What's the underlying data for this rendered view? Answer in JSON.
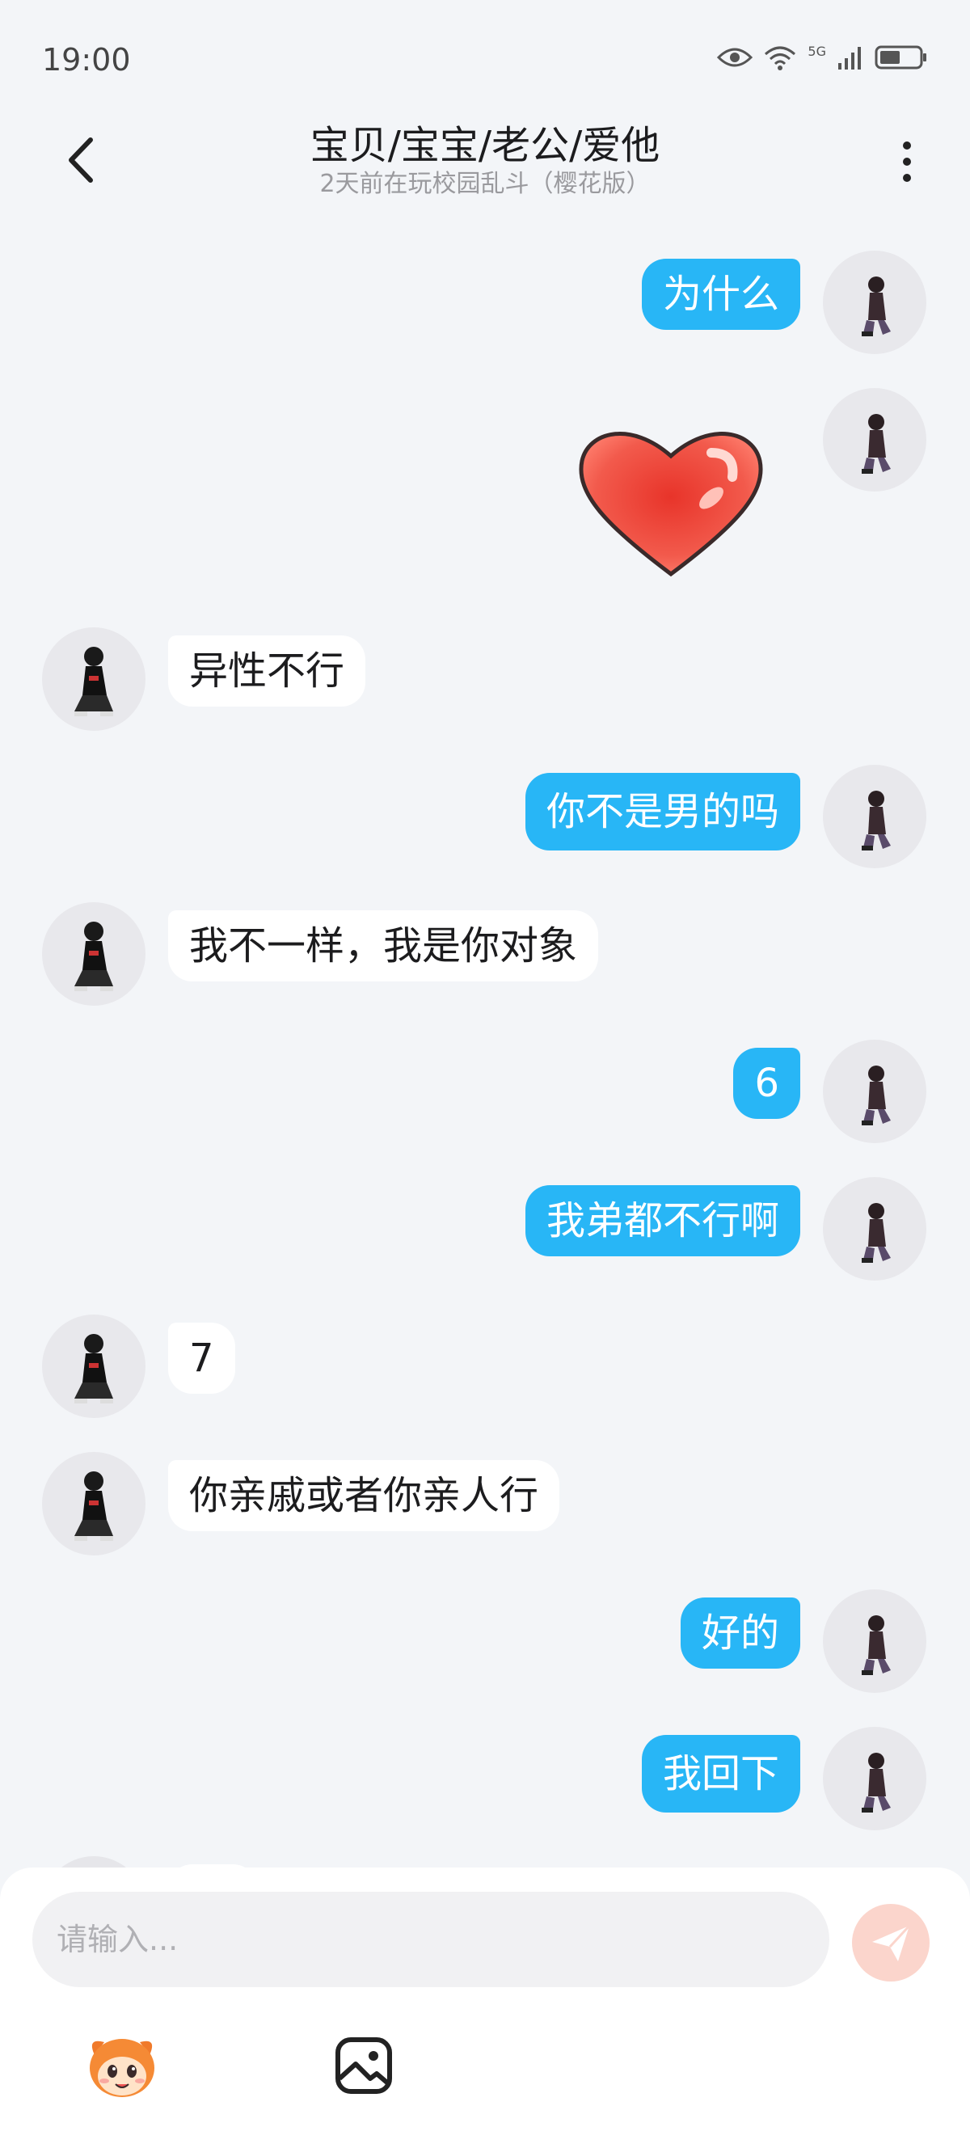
{
  "status": {
    "time": "19:00",
    "network": "5G"
  },
  "header": {
    "title": "宝贝/宝宝/老公/爱他",
    "subtitle": "2天前在玩校园乱斗（樱花版）"
  },
  "messages": [
    {
      "side": "out",
      "text": "为什么"
    },
    {
      "side": "out",
      "sticker": "heart-sticker"
    },
    {
      "side": "in",
      "text": "异性不行"
    },
    {
      "side": "out",
      "text": "你不是男的吗"
    },
    {
      "side": "in",
      "text": "我不一样，我是你对象"
    },
    {
      "side": "out",
      "text": "6"
    },
    {
      "side": "out",
      "text": "我弟都不行啊"
    },
    {
      "side": "in",
      "text": "7"
    },
    {
      "side": "in",
      "text": "你亲戚或者你亲人行"
    },
    {
      "side": "out",
      "text": "好的"
    },
    {
      "side": "out",
      "text": "我回下"
    }
  ],
  "composer": {
    "placeholder": "请输入...",
    "send_icon": "send-icon",
    "emoji_icon": "emoji-mascot-icon",
    "image_icon": "image-icon"
  },
  "colors": {
    "outgoing_bubble": "#28b6f6",
    "incoming_bubble": "#ffffff",
    "background": "#f3f5f8",
    "send_button": "#fbd5cc"
  }
}
